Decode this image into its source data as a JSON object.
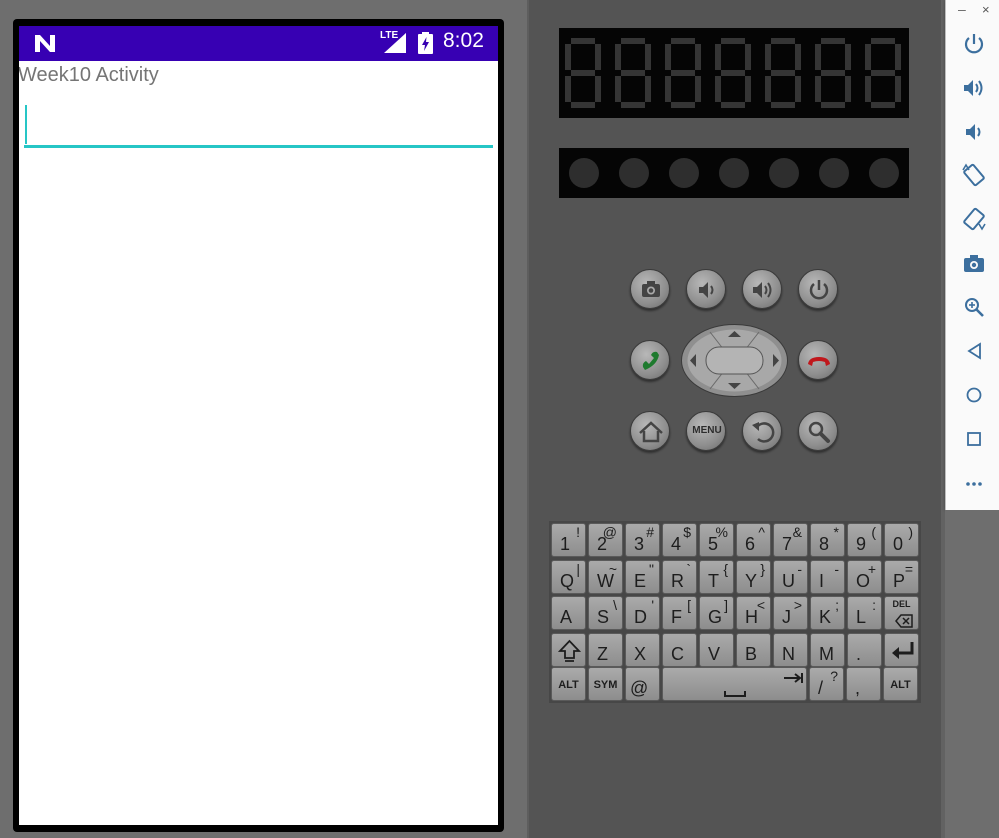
{
  "status_bar": {
    "network_label": "LTE",
    "time": "8:02",
    "color": "#3700b3"
  },
  "app": {
    "title": "Week10 Activity",
    "text_field": {
      "value": "",
      "accent_color": "#26c6c6"
    }
  },
  "emulator": {
    "segment_display_digits": 7,
    "led_count": 7,
    "menu_button_label": "MENU",
    "buttons": [
      "camera-icon",
      "volume-down-icon",
      "volume-up-icon",
      "power-icon",
      "call-icon",
      "end-call-icon",
      "home-icon",
      "back-icon",
      "search-icon"
    ],
    "keyboard": {
      "rows": [
        [
          {
            "main": "1",
            "alt": "!"
          },
          {
            "main": "2",
            "alt": "@"
          },
          {
            "main": "3",
            "alt": "#"
          },
          {
            "main": "4",
            "alt": "$"
          },
          {
            "main": "5",
            "alt": "%"
          },
          {
            "main": "6",
            "alt": "^"
          },
          {
            "main": "7",
            "alt": "&"
          },
          {
            "main": "8",
            "alt": "*"
          },
          {
            "main": "9",
            "alt": "("
          },
          {
            "main": "0",
            "alt": ")"
          }
        ],
        [
          {
            "main": "Q",
            "alt": "|"
          },
          {
            "main": "W",
            "alt": "~"
          },
          {
            "main": "E",
            "alt": "\""
          },
          {
            "main": "R",
            "alt": "`"
          },
          {
            "main": "T",
            "alt": "{"
          },
          {
            "main": "Y",
            "alt": "}"
          },
          {
            "main": "U",
            "alt": "-"
          },
          {
            "main": "I",
            "alt": "-"
          },
          {
            "main": "O",
            "alt": "+"
          },
          {
            "main": "P",
            "alt": "="
          }
        ],
        [
          {
            "main": "A",
            "alt": ""
          },
          {
            "main": "S",
            "alt": "\\"
          },
          {
            "main": "D",
            "alt": "'"
          },
          {
            "main": "F",
            "alt": "["
          },
          {
            "main": "G",
            "alt": "]"
          },
          {
            "main": "H",
            "alt": "<"
          },
          {
            "main": "J",
            "alt": ">"
          },
          {
            "main": "K",
            "alt": ";"
          },
          {
            "main": "L",
            "alt": ":"
          },
          {
            "small": "DEL"
          }
        ],
        [
          {
            "icon": "shift-icon"
          },
          {
            "main": "Z",
            "alt": ""
          },
          {
            "main": "X",
            "alt": ""
          },
          {
            "main": "C",
            "alt": ""
          },
          {
            "main": "V",
            "alt": ""
          },
          {
            "main": "B",
            "alt": ""
          },
          {
            "main": "N",
            "alt": ""
          },
          {
            "main": "M",
            "alt": ""
          },
          {
            "main": ".",
            "alt": ""
          },
          {
            "icon": "enter-icon"
          }
        ]
      ],
      "bottom": {
        "alt_left": "ALT",
        "sym": "SYM",
        "at": "@",
        "slash_main": "/",
        "slash_alt": "?",
        "comma": ",",
        "alt_right": "ALT"
      }
    }
  },
  "sidebar": {
    "items": [
      "power-icon",
      "volume-up-icon",
      "volume-down-icon",
      "rotate-left-icon",
      "rotate-right-icon",
      "screenshot-icon",
      "zoom-icon",
      "back-icon",
      "home-icon",
      "overview-icon",
      "more-icon"
    ],
    "minimize_label": "–",
    "close_label": "×"
  }
}
